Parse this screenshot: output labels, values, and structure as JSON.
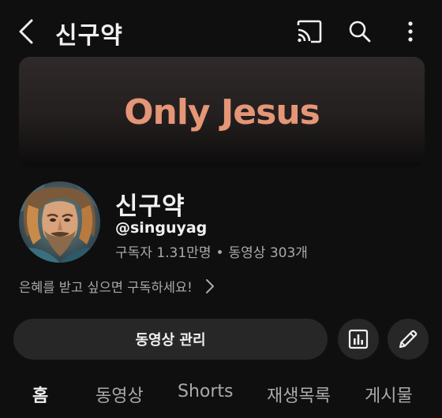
{
  "header": {
    "title": "신구약",
    "back_icon": "back-arrow-icon",
    "actions": [
      "cast-icon",
      "search-icon",
      "more-vert-icon"
    ]
  },
  "banner": {
    "text": "Only Jesus",
    "text_color": "#e49676"
  },
  "channel": {
    "name": "신구약",
    "handle": "@singuyag",
    "subscribers": "구독자 1.31만명",
    "separator": "•",
    "videos": "동영상 303개",
    "promo_text": "은혜를 받고 싶으면 구독하세요!"
  },
  "actions": {
    "manage_label": "동영상 관리",
    "analytics_icon": "analytics-icon",
    "edit_icon": "pencil-icon"
  },
  "tabs": [
    {
      "label": "홈",
      "active": true
    },
    {
      "label": "동영상",
      "active": false
    },
    {
      "label": "Shorts",
      "active": false
    },
    {
      "label": "재생목록",
      "active": false
    },
    {
      "label": "게시물",
      "active": false
    }
  ],
  "colors": {
    "background": "#0f0f0f",
    "button_bg": "#272727",
    "text_primary": "#f1f1f1",
    "text_secondary": "#aaaaaa"
  }
}
